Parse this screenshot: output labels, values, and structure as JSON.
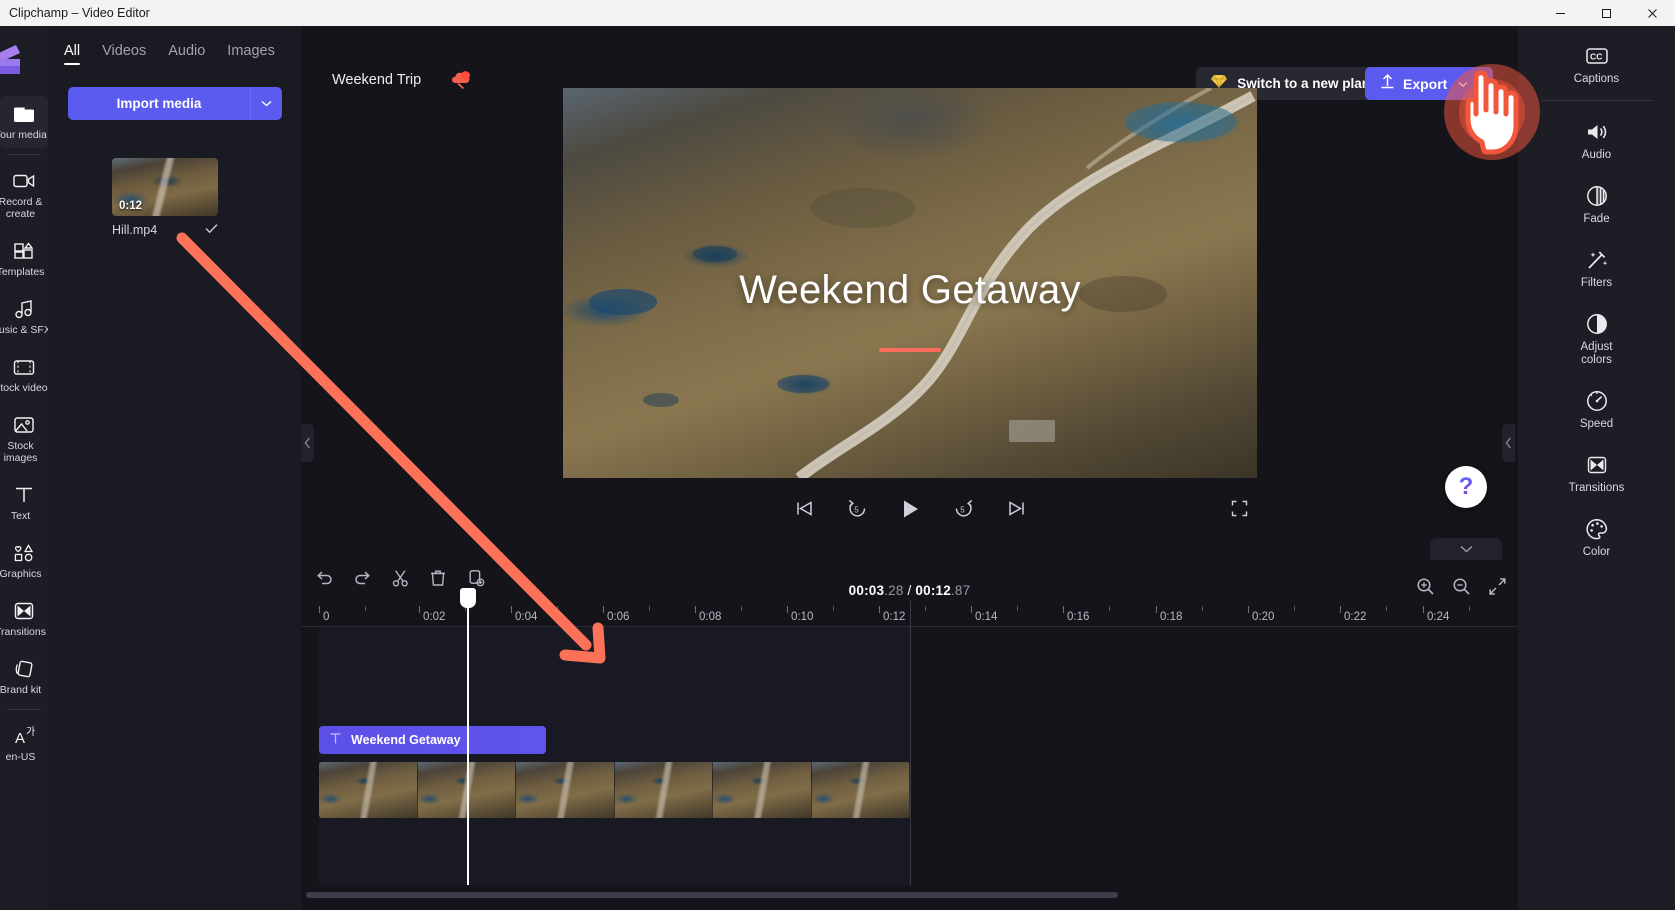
{
  "window": {
    "title": "Clipchamp – Video Editor",
    "minimize_label": "—",
    "maximize_label": "□",
    "close_label": "✕"
  },
  "left_rail": {
    "logo_name": "clipchamp-logo",
    "items": [
      {
        "label": "Your media",
        "icon": "folder-icon",
        "active": true
      },
      {
        "label": "Record &\ncreate",
        "icon": "camera-icon",
        "active": false
      },
      {
        "label": "Templates",
        "icon": "templates-icon",
        "active": false
      },
      {
        "label": "Music & SFX",
        "icon": "music-note-icon",
        "active": false
      },
      {
        "label": "Stock video",
        "icon": "film-strip-icon",
        "active": false
      },
      {
        "label": "Stock\nimages",
        "icon": "image-icon",
        "active": false
      },
      {
        "label": "Text",
        "icon": "text-t-icon",
        "active": false
      },
      {
        "label": "Graphics",
        "icon": "shapes-icon",
        "active": false
      },
      {
        "label": "Transitions",
        "icon": "transition-icon",
        "active": false
      },
      {
        "label": "Brand kit",
        "icon": "brand-kit-icon",
        "active": false
      },
      {
        "label": "en-US",
        "icon": "language-icon",
        "active": false
      }
    ]
  },
  "media_panel": {
    "tabs": [
      {
        "label": "All",
        "active": true
      },
      {
        "label": "Videos",
        "active": false
      },
      {
        "label": "Audio",
        "active": false
      },
      {
        "label": "Images",
        "active": false
      }
    ],
    "import_label": "Import media",
    "import_caret_icon": "chevron-down-icon",
    "assets": [
      {
        "name": "Hill.mp4",
        "duration": "0:12",
        "selected_icon": "check-icon"
      }
    ]
  },
  "header": {
    "project_title": "Weekend Trip",
    "save_status_icon": "cloud-saved-icon",
    "plan_button_label": "Switch to a new plan",
    "plan_button_icon": "diamond-icon",
    "export_label": "Export",
    "export_icon": "upload-arrow-icon",
    "export_caret_icon": "chevron-down-icon"
  },
  "preview": {
    "overlay_text": "Weekend Getaway",
    "controls": [
      {
        "name": "skip-to-start",
        "icon": "skip-back-icon"
      },
      {
        "name": "rewind-5s",
        "icon": "back-5-icon"
      },
      {
        "name": "play",
        "icon": "play-icon"
      },
      {
        "name": "forward-5s",
        "icon": "forward-5-icon"
      },
      {
        "name": "skip-to-end",
        "icon": "skip-forward-icon"
      }
    ],
    "fullscreen_icon": "fullscreen-icon",
    "help_label": "?"
  },
  "right_rail": {
    "items": [
      {
        "label": "Captions",
        "icon": "cc-icon"
      },
      {
        "label": "Audio",
        "icon": "speaker-icon"
      },
      {
        "label": "Fade",
        "icon": "fade-icon"
      },
      {
        "label": "Filters",
        "icon": "magic-wand-icon"
      },
      {
        "label": "Adjust\ncolors",
        "icon": "contrast-circle-icon"
      },
      {
        "label": "Speed",
        "icon": "speedometer-icon"
      },
      {
        "label": "Transitions",
        "icon": "transition-icon"
      },
      {
        "label": "Color",
        "icon": "palette-icon"
      }
    ]
  },
  "timeline": {
    "tools": [
      {
        "name": "undo",
        "icon": "undo-arrow-icon"
      },
      {
        "name": "redo",
        "icon": "redo-arrow-icon"
      },
      {
        "name": "split",
        "icon": "scissors-icon"
      },
      {
        "name": "delete",
        "icon": "trash-icon"
      },
      {
        "name": "duplicate",
        "icon": "duplicate-icon"
      }
    ],
    "current_time": "00:03",
    "current_frac": ".28",
    "separator": " / ",
    "total_time": "00:12",
    "total_frac": ".87",
    "zoom_controls": [
      {
        "name": "zoom-in",
        "icon": "magnifier-plus-icon"
      },
      {
        "name": "zoom-out",
        "icon": "magnifier-minus-icon"
      },
      {
        "name": "fit-to-timeline",
        "icon": "fit-arrows-icon"
      }
    ],
    "ruler_labels": [
      "0",
      "0:02",
      "0:04",
      "0:06",
      "0:08",
      "0:10",
      "0:12",
      "0:14",
      "0:16",
      "0:18",
      "0:20",
      "0:22",
      "0:24"
    ],
    "text_track": {
      "clip_label": "Weekend Getaway",
      "clip_icon": "text-t-icon"
    },
    "video_track": {
      "frame_count": 6
    }
  },
  "annotation": {
    "arrow_name": "red-arrow-pointing-to-timeline",
    "cursor_name": "pointing-hand-cursor",
    "highlight_name": "red-click-highlight",
    "accent_color": "#fc7259"
  },
  "colors": {
    "accent_purple": "#5b5bf0",
    "app_bg": "#14141a",
    "rail_bg": "#1d1d26",
    "panel_bg": "#1a1a22",
    "titlebar_bg": "#f3f3f3",
    "annotation_red": "#fc7259",
    "plan_gold": "#f2c94c"
  }
}
